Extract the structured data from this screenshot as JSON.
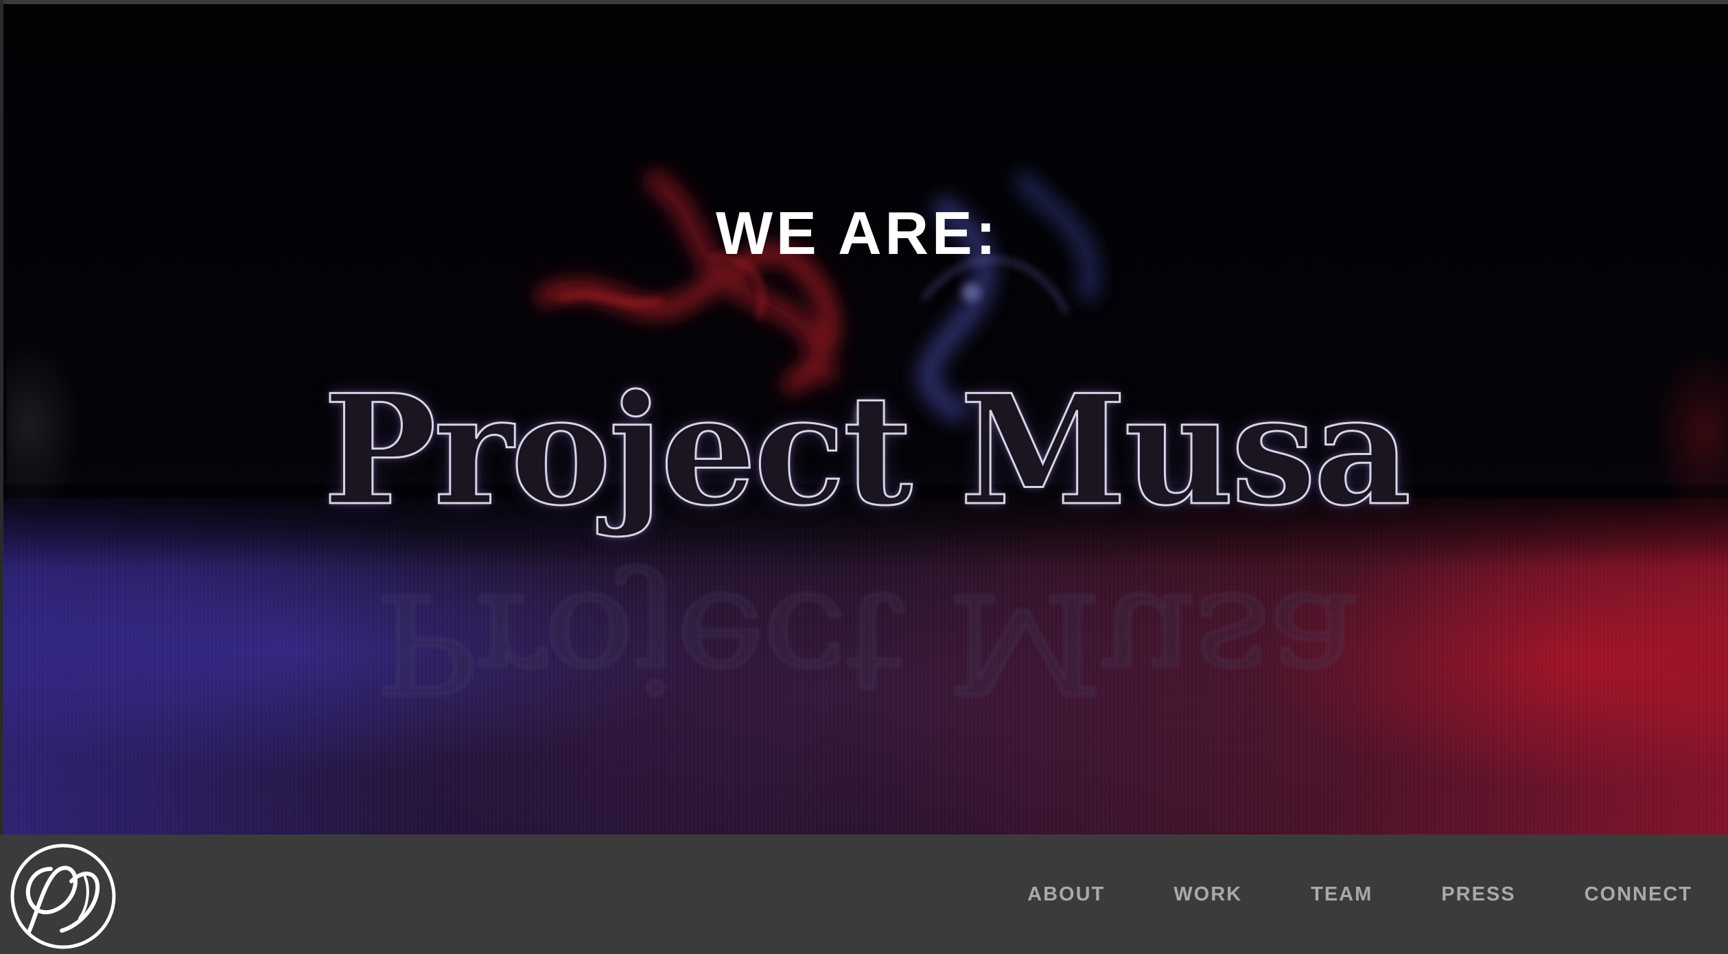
{
  "hero": {
    "headline": "WE ARE:",
    "brand_title": "Project Musa"
  },
  "nav": {
    "items": [
      {
        "label": "ABOUT"
      },
      {
        "label": "WORK"
      },
      {
        "label": "TEAM"
      },
      {
        "label": "PRESS"
      },
      {
        "label": "CONNECT"
      }
    ]
  },
  "icons": {
    "logo": "musa-monogram-logo-icon"
  },
  "colors": {
    "navbar_background": "#3b3b3b",
    "nav_text": "#a9a9a9",
    "headline_text": "#ffffff",
    "hero_blue": "#3c32be",
    "hero_red": "#d21428"
  }
}
